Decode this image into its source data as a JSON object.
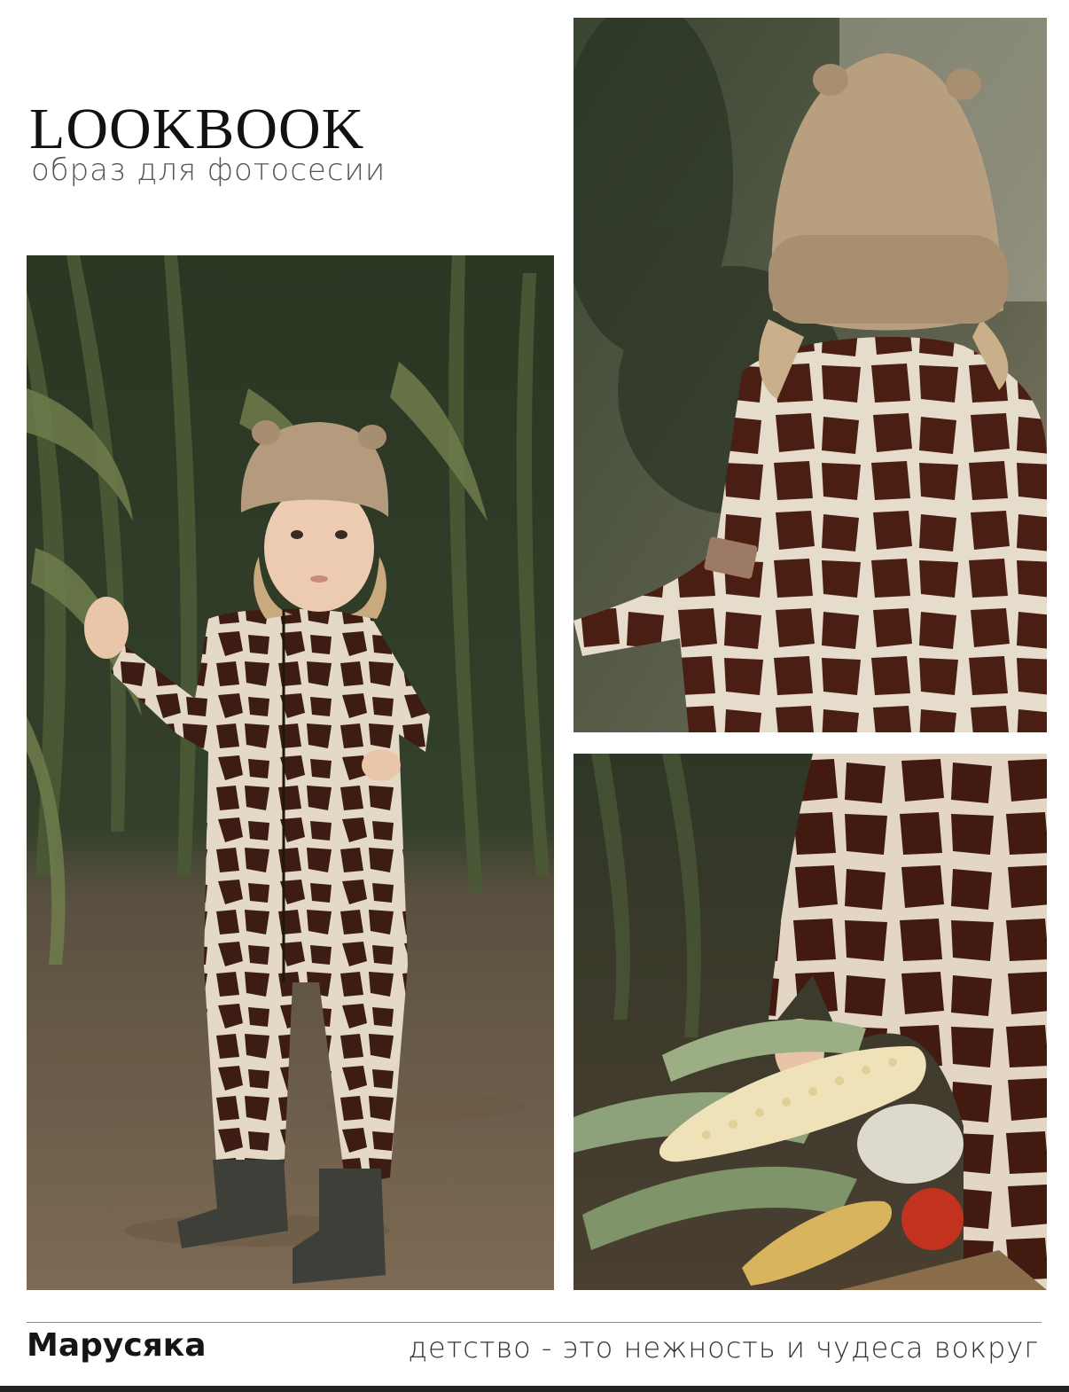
{
  "header": {
    "title": "LOOKBOOK",
    "subtitle": "образ для фотосесии"
  },
  "photos": {
    "main": {
      "subject": "child-in-giraffe-jumpsuit-corn-field"
    },
    "top_right": {
      "subject": "child-back-view-knit-hat"
    },
    "bottom_right": {
      "subject": "child-hand-holding-corn"
    }
  },
  "footer": {
    "name": "Марусяка",
    "tagline": "детство - это нежность и чудеса вокруг"
  },
  "colors": {
    "background": "#ffffff",
    "title": "#111111",
    "subtitle": "#555555",
    "divider": "#8a8a8a",
    "foliage": "#2f3a24",
    "soil": "#7a6650",
    "giraffe_dark": "#3e1d14",
    "giraffe_light": "#e6dccb",
    "hat": "#b39a7c"
  }
}
